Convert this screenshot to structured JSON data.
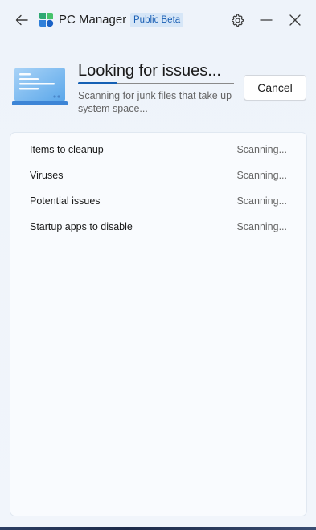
{
  "titlebar": {
    "app_name": "PC Manager",
    "badge": "Public Beta",
    "icons": {
      "back": "back-arrow-icon",
      "logo": "pc-manager-logo-icon",
      "settings": "gear-icon",
      "minimize": "minimize-icon",
      "close": "close-icon"
    }
  },
  "scan": {
    "title": "Looking for issues...",
    "subtitle": "Scanning for junk files that take up system space...",
    "progress_percent": 25,
    "cancel_label": "Cancel",
    "icon": "laptop-scan-icon"
  },
  "results": [
    {
      "label": "Items to cleanup",
      "status": "Scanning..."
    },
    {
      "label": "Viruses",
      "status": "Scanning..."
    },
    {
      "label": "Potential issues",
      "status": "Scanning..."
    },
    {
      "label": "Startup apps to disable",
      "status": "Scanning..."
    }
  ],
  "colors": {
    "accent": "#1460b4",
    "badge_bg": "#d6e6f7",
    "badge_text": "#1a5fb4"
  }
}
